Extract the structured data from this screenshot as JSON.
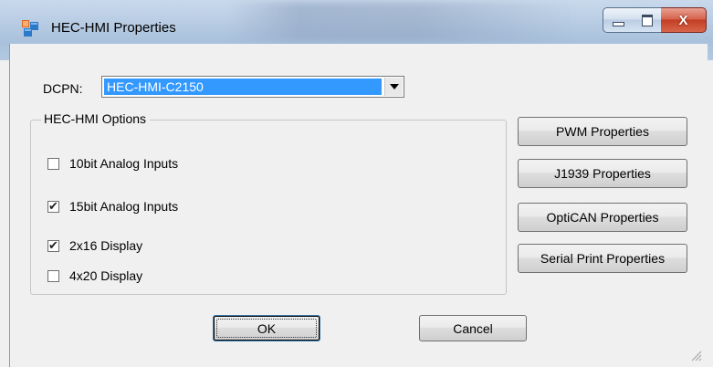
{
  "window": {
    "title": "HEC-HMI Properties",
    "icon": "app-window-icon",
    "controls": {
      "minimize_icon": "minimize-icon",
      "maximize_icon": "maximize-icon",
      "close_icon": "close-icon",
      "close_glyph": "X"
    }
  },
  "form": {
    "dcpn_label": "DCPN:",
    "dcpn_value": "HEC-HMI-C2150",
    "options_group_title": "HEC-HMI Options",
    "options": [
      {
        "label": "10bit Analog Inputs",
        "checked": false
      },
      {
        "label": "15bit Analog Inputs",
        "checked": true
      },
      {
        "label": "2x16 Display",
        "checked": true
      },
      {
        "label": "4x20 Display",
        "checked": false
      }
    ],
    "check_glyph": "✔"
  },
  "side_buttons": {
    "pwm": "PWM Properties",
    "j1939": "J1939 Properties",
    "opticán_placeholder": "",
    "optican": "OptiCAN Properties",
    "serial": "Serial Print Properties"
  },
  "dialog_buttons": {
    "ok": "OK",
    "cancel": "Cancel"
  },
  "colors": {
    "selection": "#3399ff",
    "close_button": "#c33f24"
  }
}
